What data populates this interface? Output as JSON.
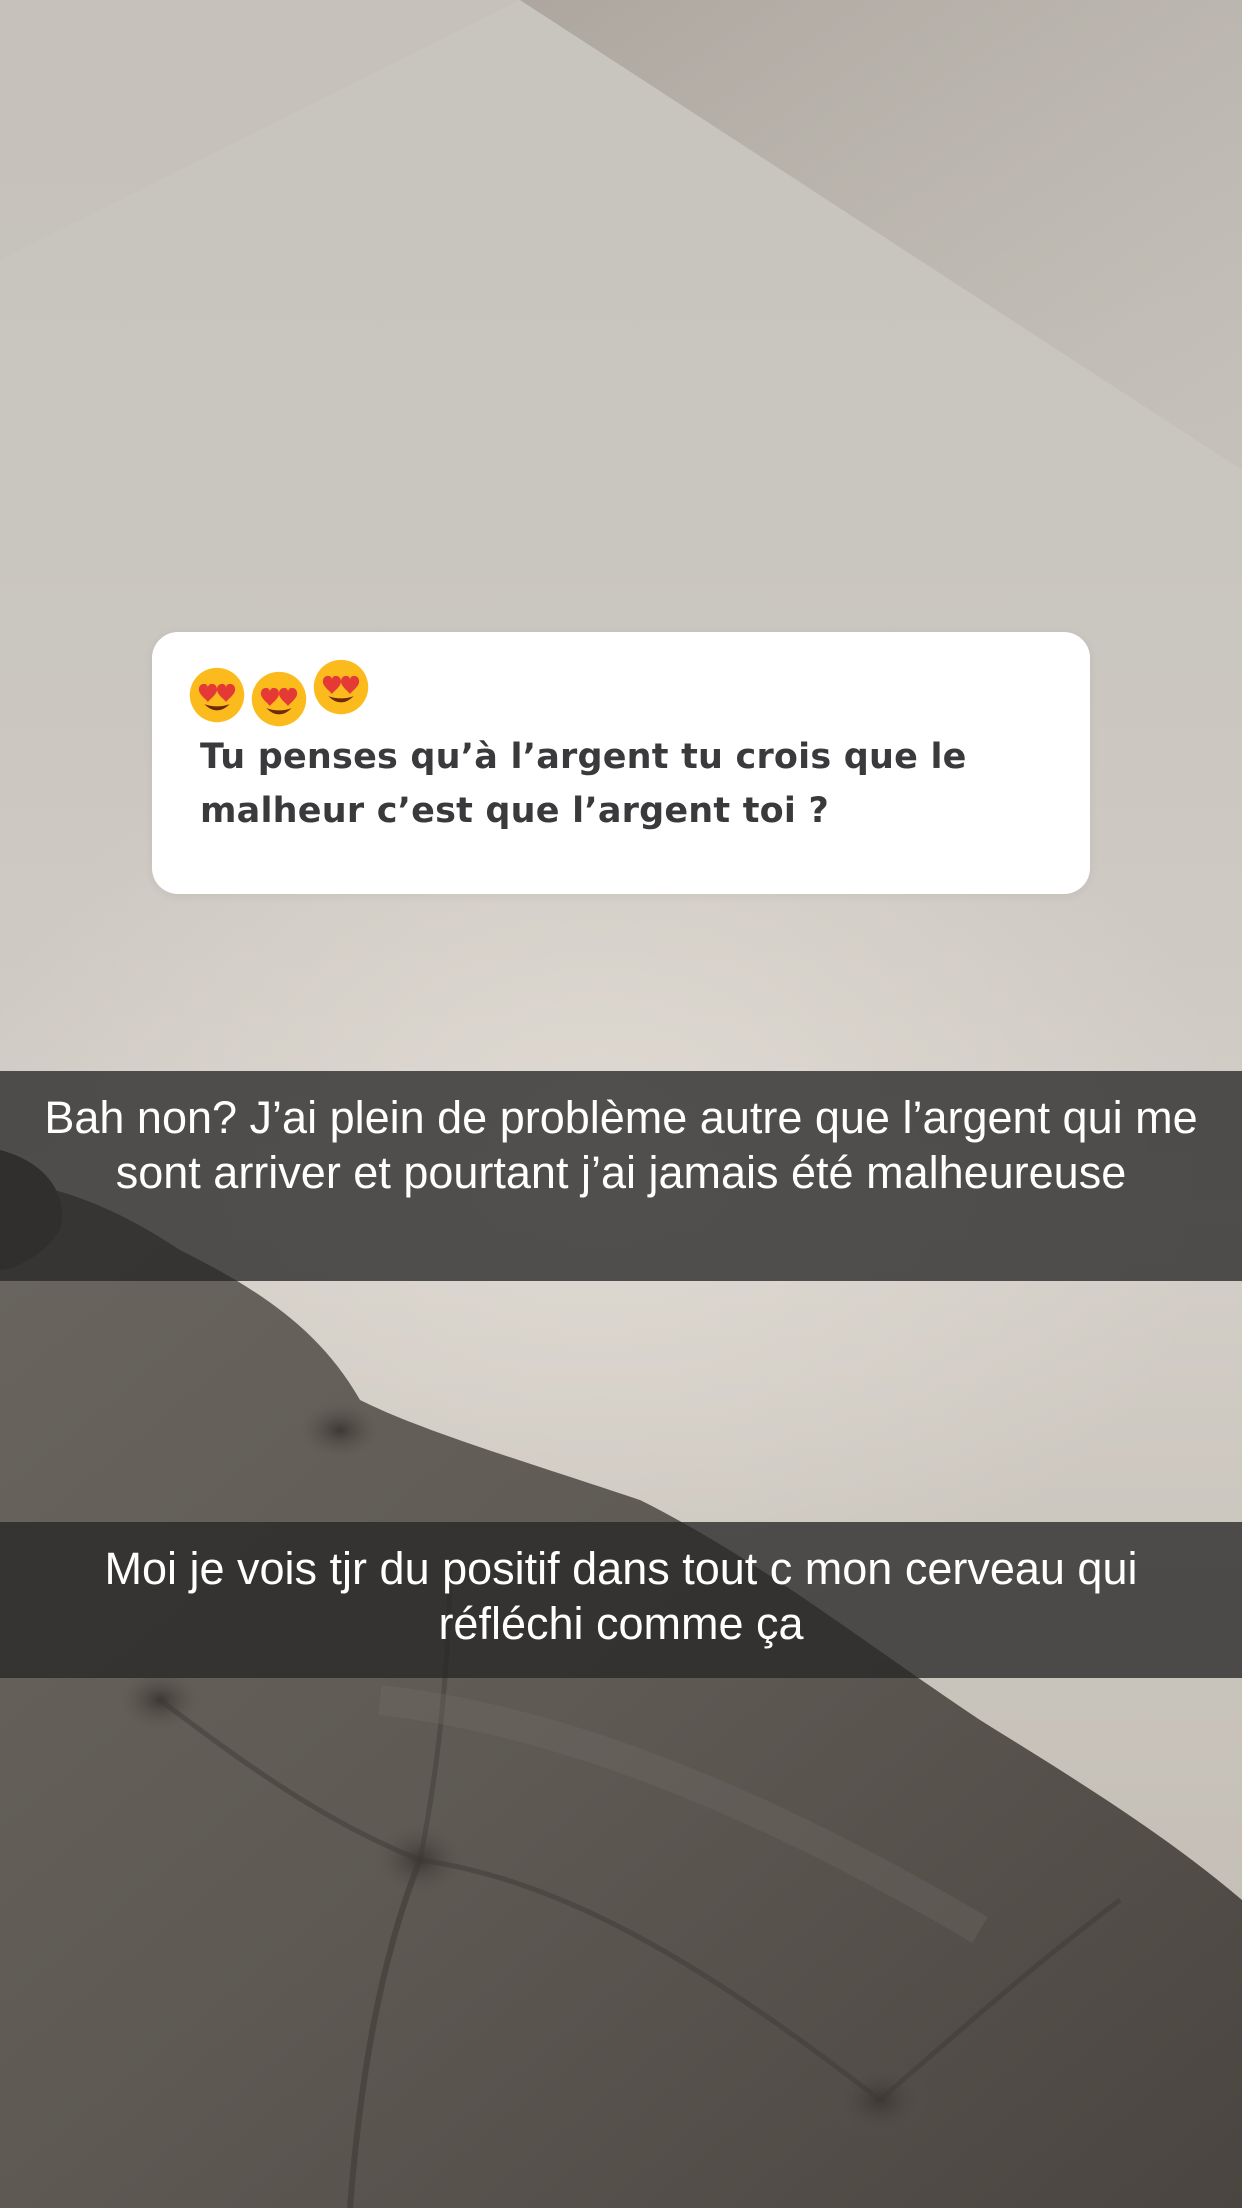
{
  "question_sticker": {
    "emojis": [
      "heart-eyes-emoji",
      "heart-eyes-emoji",
      "heart-eyes-emoji"
    ],
    "question": "Tu penses qu’à l’argent tu crois que le malheur c’est que l’argent toi ?"
  },
  "captions": [
    {
      "text": "Bah non? J’ai plein de problème autre que l’argent qui me sont arriver et pourtant j’ai jamais été malheureuse"
    },
    {
      "text": "Moi je vois tjr du positif dans tout c mon cerveau qui réfléchi comme ça"
    }
  ],
  "colors": {
    "caption_bar": "#282828",
    "card_background": "#ffffff",
    "question_text": "#3a3a3d"
  }
}
